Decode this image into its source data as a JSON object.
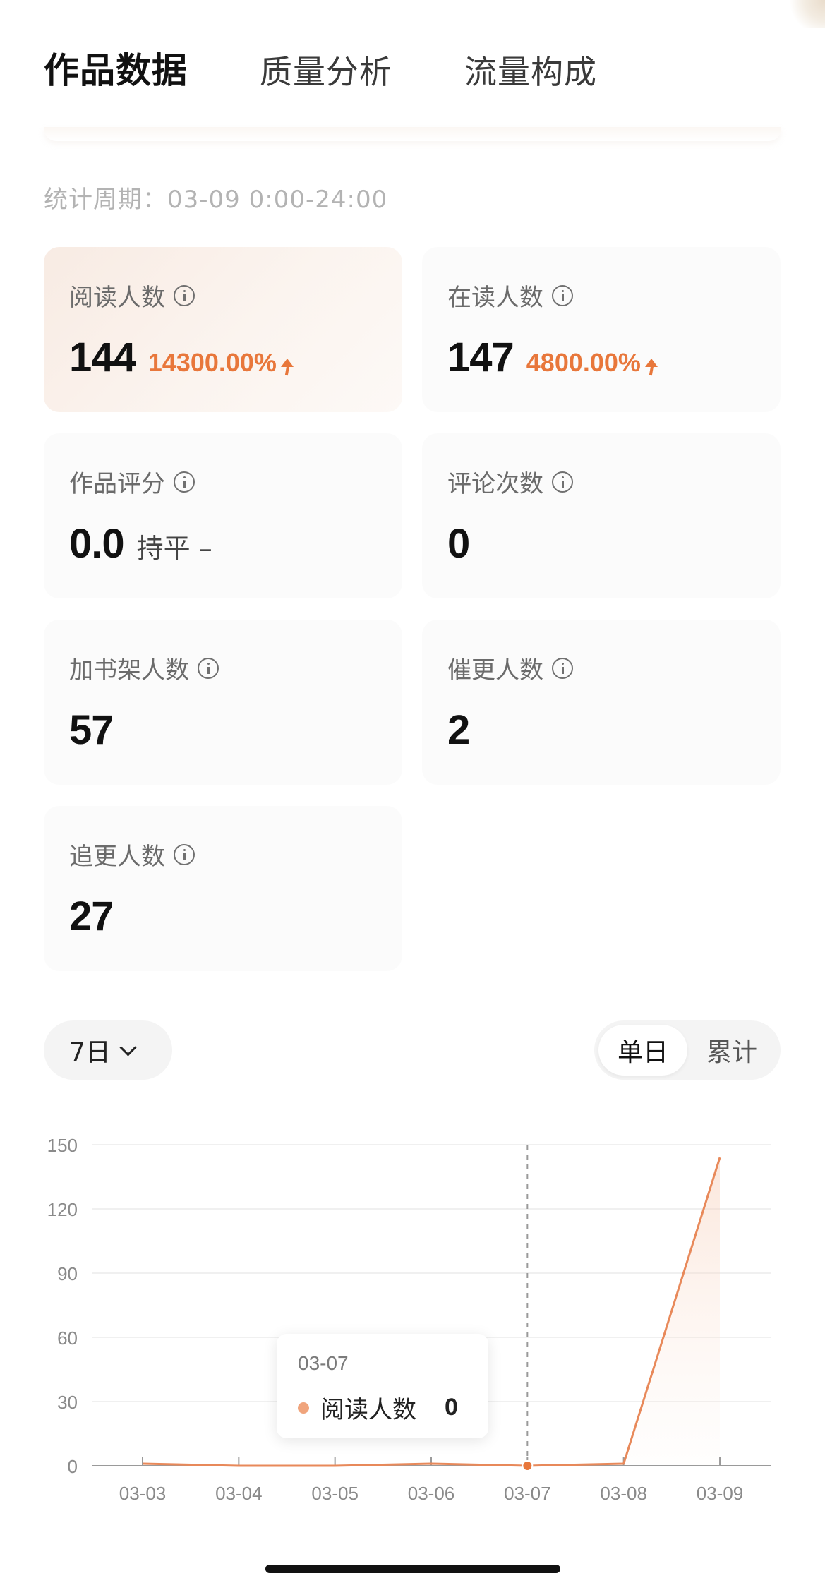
{
  "tabs": [
    {
      "label": "作品数据",
      "active": true
    },
    {
      "label": "质量分析",
      "active": false
    },
    {
      "label": "流量构成",
      "active": false
    }
  ],
  "period": {
    "text": "统计周期：03-09 0:00-24:00"
  },
  "metrics": [
    {
      "label": "阅读人数",
      "value": "144",
      "change": "14300.00%",
      "trend": "up",
      "highlight": true
    },
    {
      "label": "在读人数",
      "value": "147",
      "change": "4800.00%",
      "trend": "up",
      "highlight": false
    },
    {
      "label": "作品评分",
      "value": "0.0",
      "change": "持平 –",
      "trend": "flat",
      "highlight": false
    },
    {
      "label": "评论次数",
      "value": "0",
      "change": "",
      "trend": "none",
      "highlight": false
    },
    {
      "label": "加书架人数",
      "value": "57",
      "change": "",
      "trend": "none",
      "highlight": false
    },
    {
      "label": "催更人数",
      "value": "2",
      "change": "",
      "trend": "none",
      "highlight": false
    },
    {
      "label": "追更人数",
      "value": "27",
      "change": "",
      "trend": "none",
      "highlight": false
    }
  ],
  "controls": {
    "range_label": "7日",
    "segment": [
      {
        "label": "单日",
        "active": true
      },
      {
        "label": "累计",
        "active": false
      }
    ]
  },
  "tooltip": {
    "date": "03-07",
    "series_label": "阅读人数",
    "value": "0"
  },
  "colors": {
    "accent": "#e8773b",
    "line": "#e8895a",
    "grid": "#ececec"
  },
  "chart_data": {
    "type": "line",
    "x": [
      "03-03",
      "03-04",
      "03-05",
      "03-06",
      "03-07",
      "03-08",
      "03-09"
    ],
    "series": [
      {
        "name": "阅读人数",
        "values": [
          1,
          0,
          0,
          1,
          0,
          1,
          144
        ]
      }
    ],
    "y_ticks": [
      "0",
      "30",
      "60",
      "90",
      "120",
      "150"
    ],
    "ylim": [
      0,
      150
    ],
    "grid": true,
    "highlight_index": 4
  }
}
